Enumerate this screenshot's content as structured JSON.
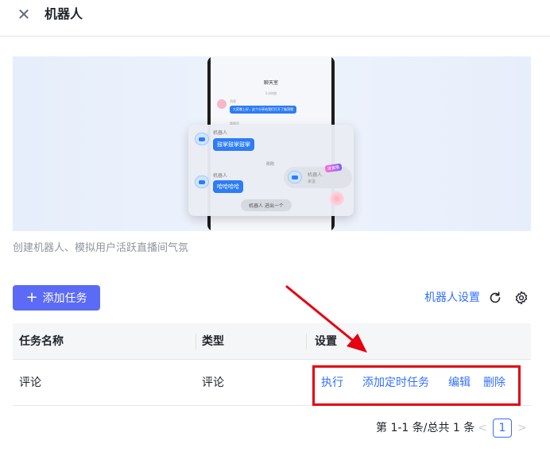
{
  "header": {
    "title": "机器人",
    "close_icon": "close-icon"
  },
  "banner": {
    "phone": {
      "title": "聊天室",
      "time": "1小时前",
      "messages": [
        {
          "name": "消息",
          "text": "大家晚上好，这个分享给我们打开了脑洞哦"
        },
        {
          "name": "管理员",
          "text": ""
        }
      ]
    },
    "panel": {
      "msg1_name": "机器人",
      "msg1_text": "鼓掌鼓掌鼓掌",
      "time": "刚刚",
      "msg2_name": "机器人",
      "msg2_text": "哈哈哈哈",
      "card_name": "机器人",
      "card_tag": "进直播",
      "card_sub": "来蛋",
      "pill": "机器人 进出一个"
    }
  },
  "description": "创建机器人、模拟用户活跃直播间气氛",
  "toolbar": {
    "add_label": "添加任务",
    "robot_settings": "机器人设置",
    "refresh_icon": "refresh-icon",
    "settings_icon": "gear-icon"
  },
  "table": {
    "headers": [
      "任务名称",
      "类型",
      "设置"
    ],
    "rows": [
      {
        "name": "评论",
        "type": "评论",
        "actions": [
          "执行",
          "添加定时任务",
          "编辑",
          "删除"
        ]
      }
    ]
  },
  "pagination": {
    "total": "第 1-1 条/总共 1 条",
    "current": "1",
    "prev": "<",
    "next": ">"
  },
  "colors": {
    "primary_button": "#5b6bf5",
    "link": "#3370ff",
    "highlight_box": "#e60012"
  }
}
